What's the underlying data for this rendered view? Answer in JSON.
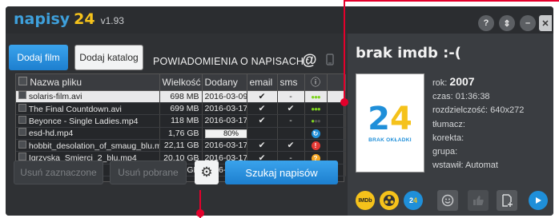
{
  "app": {
    "logo_text": "napisy",
    "logo_number": "24",
    "version": "v1.93"
  },
  "window_buttons": [
    "?",
    "⇕",
    "–",
    "✕"
  ],
  "toolbar": {
    "add_film": "Dodaj film",
    "add_folder": "Dodaj katalog",
    "notifications_label": "POWIADOMIENIA O NAPISACH :",
    "at_symbol": "@"
  },
  "table": {
    "columns": [
      "Nazwa pliku",
      "Wielkość",
      "Dodany",
      "email",
      "sms",
      "ⓘ"
    ],
    "rows": [
      {
        "name": "solaris-film.avi",
        "size": "698 MB",
        "date": "2016-03-09",
        "email": "✔",
        "sms": "-",
        "status": "green3",
        "selected": true
      },
      {
        "name": "The Final Countdown.avi",
        "size": "699 MB",
        "date": "2016-03-17",
        "email": "✔",
        "sms": "✔",
        "status": "green3",
        "selected": false
      },
      {
        "name": "Beyonce - Single Ladies.mp4",
        "size": "118 MB",
        "date": "2016-03-17",
        "email": "✔",
        "sms": "-",
        "status": "green1",
        "selected": false
      },
      {
        "name": "esd-hd.mp4",
        "size": "1,76 GB",
        "date": "",
        "progress": "80%",
        "progress_value": 0.8,
        "email": "",
        "sms": "",
        "status": "blue",
        "selected": false
      },
      {
        "name": "hobbit_desolation_of_smaug_blu.mp4",
        "size": "22,11 GB",
        "date": "2016-03-17",
        "email": "✔",
        "sms": "✔",
        "status": "red",
        "selected": false
      },
      {
        "name": "Igrzyska_Smierci_2_blu.mp4",
        "size": "20,10 GB",
        "date": "2016-03-17",
        "email": "✔",
        "sms": "-",
        "status": "orange",
        "selected": false
      },
      {
        "name": "Riddick_blu.mp4",
        "size": "16,54 GB",
        "date": "2016-03-17",
        "email": "✔",
        "sms": "✔",
        "status": "green2",
        "selected": false
      }
    ]
  },
  "actions": {
    "remove_selected": "Usuń zaznaczone",
    "remove_downloaded": "Usuń pobrane",
    "search": "Szukaj napisów"
  },
  "details": {
    "title": "brak imdb :-(",
    "cover_number_2": "2",
    "cover_number_4": "4",
    "cover_caption": "BRAK OKŁADKI",
    "year_label": "rok:",
    "year": "2007",
    "time": "czas: 01:36:38",
    "resolution": "rozdzielczość: 640x272",
    "translator": "tłumacz:",
    "correction": "korekta:",
    "group": "grupa:",
    "inserted": "wstawił: Automat"
  },
  "colors": {
    "accent": "#1f8fd9",
    "yellow": "#f5c21b",
    "annotation": "#e4002b"
  }
}
